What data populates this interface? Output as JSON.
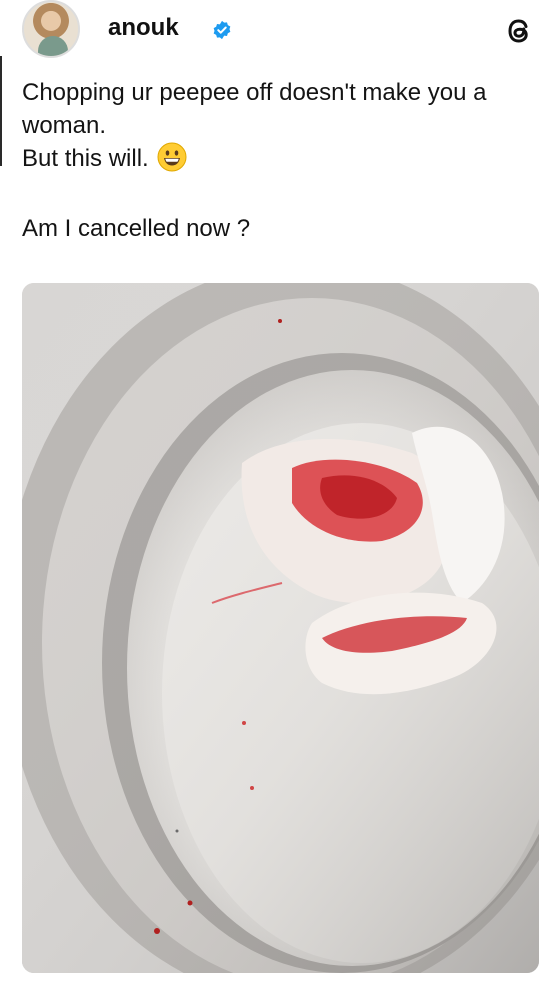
{
  "post": {
    "author": {
      "username": "anouk",
      "verified": true
    },
    "app_icon": "threads-icon",
    "lines": [
      "Chopping ur peepee off doesn't make you a woman.",
      "But this will.",
      "Am I cancelled now ?"
    ],
    "emoji": "grinning-face-emoji",
    "media": {
      "type": "photo"
    }
  },
  "colors": {
    "verified_blue": "#1d9bf0",
    "text": "#141414"
  }
}
